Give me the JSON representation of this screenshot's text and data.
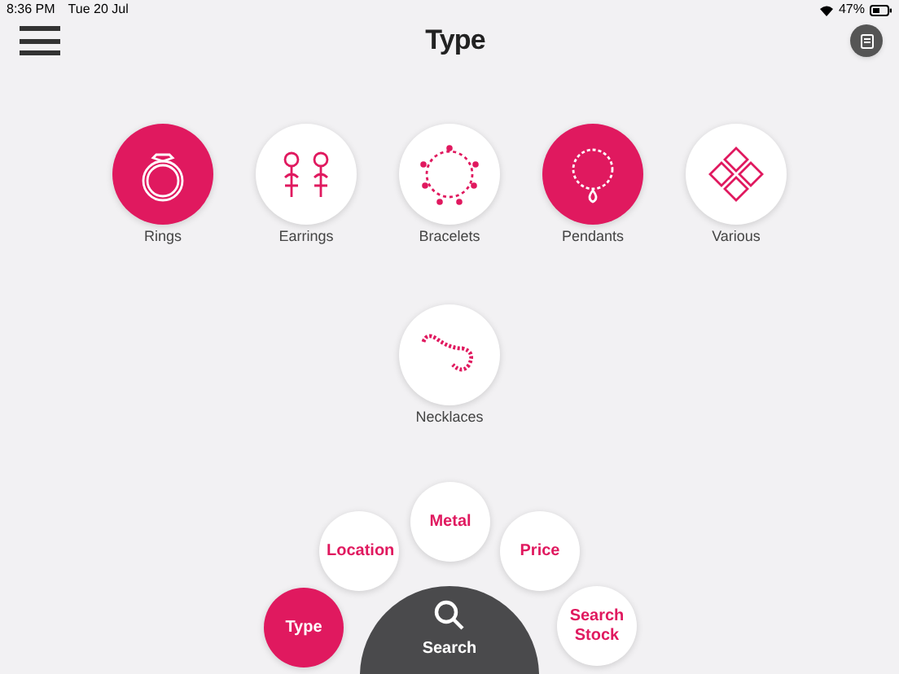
{
  "status_bar": {
    "time": "8:36 PM",
    "date": "Tue 20 Jul",
    "battery": "47%"
  },
  "header": {
    "title": "Type"
  },
  "categories": [
    {
      "label": "Rings",
      "selected": true
    },
    {
      "label": "Earrings",
      "selected": false
    },
    {
      "label": "Bracelets",
      "selected": false
    },
    {
      "label": "Pendants",
      "selected": true
    },
    {
      "label": "Various",
      "selected": false
    },
    {
      "label": "Necklaces",
      "selected": false
    }
  ],
  "filter_menu": [
    {
      "label": "Type",
      "selected": true
    },
    {
      "label": "Location",
      "selected": false
    },
    {
      "label": "Metal",
      "selected": false
    },
    {
      "label": "Price",
      "selected": false
    },
    {
      "label": "Search Stock",
      "selected": false
    }
  ],
  "search_button": {
    "label": "Search"
  }
}
